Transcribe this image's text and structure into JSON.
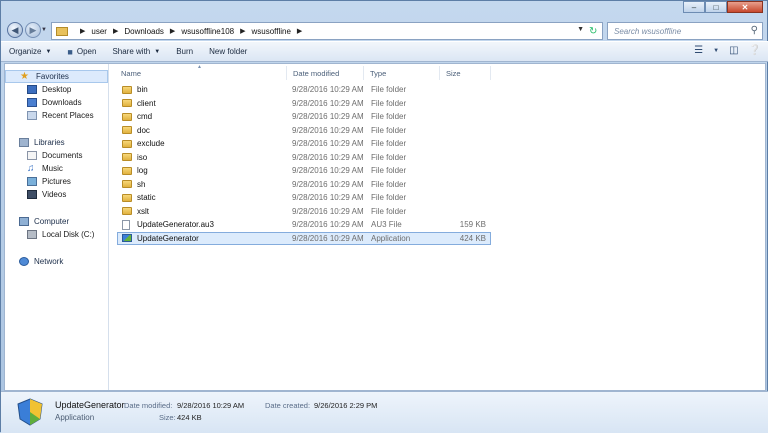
{
  "search": {
    "placeholder": "Search wsusoffline"
  },
  "breadcrumb": [
    "user",
    "Downloads",
    "wsusoffline108",
    "wsusoffline"
  ],
  "toolbar": {
    "organize": "Organize",
    "open": "Open",
    "share_with": "Share with",
    "burn": "Burn",
    "new_folder": "New folder"
  },
  "sidebar": {
    "favorites": {
      "label": "Favorites",
      "items": [
        "Desktop",
        "Downloads",
        "Recent Places"
      ]
    },
    "libraries": {
      "label": "Libraries",
      "items": [
        "Documents",
        "Music",
        "Pictures",
        "Videos"
      ]
    },
    "computer": {
      "label": "Computer",
      "items": [
        "Local Disk (C:)"
      ]
    },
    "network": {
      "label": "Network"
    }
  },
  "columns": {
    "name": "Name",
    "date": "Date modified",
    "type": "Type",
    "size": "Size"
  },
  "files": [
    {
      "name": "bin",
      "date": "9/28/2016 10:29 AM",
      "type": "File folder",
      "size": "",
      "kind": "folder"
    },
    {
      "name": "client",
      "date": "9/28/2016 10:29 AM",
      "type": "File folder",
      "size": "",
      "kind": "folder"
    },
    {
      "name": "cmd",
      "date": "9/28/2016 10:29 AM",
      "type": "File folder",
      "size": "",
      "kind": "folder"
    },
    {
      "name": "doc",
      "date": "9/28/2016 10:29 AM",
      "type": "File folder",
      "size": "",
      "kind": "folder"
    },
    {
      "name": "exclude",
      "date": "9/28/2016 10:29 AM",
      "type": "File folder",
      "size": "",
      "kind": "folder"
    },
    {
      "name": "iso",
      "date": "9/28/2016 10:29 AM",
      "type": "File folder",
      "size": "",
      "kind": "folder"
    },
    {
      "name": "log",
      "date": "9/28/2016 10:29 AM",
      "type": "File folder",
      "size": "",
      "kind": "folder"
    },
    {
      "name": "sh",
      "date": "9/28/2016 10:29 AM",
      "type": "File folder",
      "size": "",
      "kind": "folder"
    },
    {
      "name": "static",
      "date": "9/28/2016 10:29 AM",
      "type": "File folder",
      "size": "",
      "kind": "folder"
    },
    {
      "name": "xslt",
      "date": "9/28/2016 10:29 AM",
      "type": "File folder",
      "size": "",
      "kind": "folder"
    },
    {
      "name": "UpdateGenerator.au3",
      "date": "9/28/2016 10:29 AM",
      "type": "AU3 File",
      "size": "159 KB",
      "kind": "file"
    },
    {
      "name": "UpdateGenerator",
      "date": "9/28/2016 10:29 AM",
      "type": "Application",
      "size": "424 KB",
      "kind": "app",
      "selected": true
    }
  ],
  "details": {
    "name": "UpdateGenerator",
    "type": "Application",
    "date_modified_label": "Date modified:",
    "date_modified": "9/28/2016 10:29 AM",
    "size_label": "Size:",
    "size": "424 KB",
    "date_created_label": "Date created:",
    "date_created": "9/26/2016 2:29 PM"
  },
  "icons": {
    "back": "back-arrow-icon",
    "forward": "forward-arrow-icon",
    "refresh": "refresh-icon",
    "search": "search-icon",
    "views": "views-icon",
    "preview": "preview-pane-icon",
    "help": "help-icon"
  },
  "colors": {
    "selection": "#dcebfc",
    "selection_border": "#84acdd",
    "folder": "#e8c15c"
  }
}
